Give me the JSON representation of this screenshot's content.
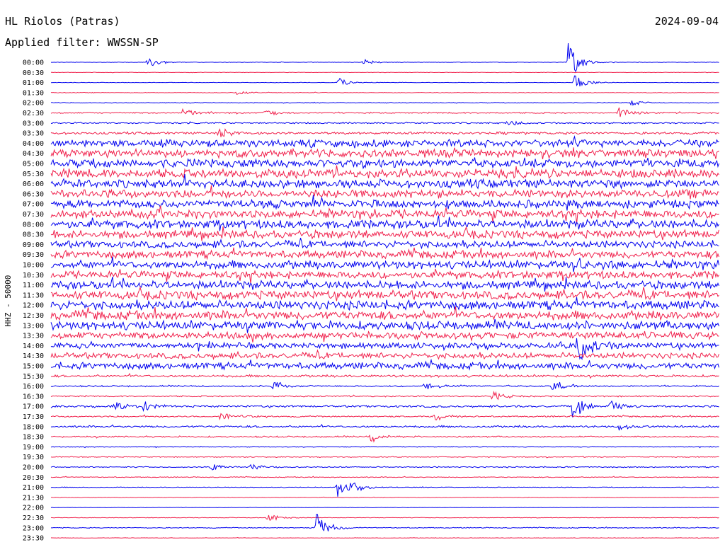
{
  "header": {
    "station": "HL Riolos (Patras)",
    "date": "2024-09-04",
    "filter": "Applied filter: WWSSN-SP"
  },
  "ylabel": "HHZ - 50000",
  "colors": {
    "even_rows": "#0000ee",
    "odd_rows": "#f0204c",
    "text": "#000000"
  },
  "chart_data": {
    "type": "line",
    "title": "HL Riolos (Patras)",
    "date": "2024-09-04",
    "filter": "WWSSN-SP",
    "ylabel": "HHZ - 50000",
    "grid": false,
    "row_labels": [
      "00:00",
      "00:30",
      "01:00",
      "01:30",
      "02:00",
      "02:30",
      "03:00",
      "03:30",
      "04:00",
      "04:30",
      "05:00",
      "05:30",
      "06:00",
      "06:30",
      "07:00",
      "07:30",
      "08:00",
      "08:30",
      "09:00",
      "09:30",
      "10:00",
      "10:30",
      "11:00",
      "11:30",
      "12:00",
      "12:30",
      "13:00",
      "13:30",
      "14:00",
      "14:30",
      "15:00",
      "15:30",
      "16:00",
      "16:30",
      "17:00",
      "17:30",
      "18:00",
      "18:30",
      "19:00",
      "19:30",
      "20:00",
      "20:30",
      "21:00",
      "21:30",
      "22:00",
      "22:30",
      "23:00",
      "23:30"
    ],
    "row_colors": [
      "#0000ee",
      "#f0204c"
    ],
    "row_minutes": 30,
    "noise_level": [
      0.3,
      0.3,
      0.3,
      0.4,
      0.5,
      0.9,
      1.0,
      1.6,
      5.0,
      5.5,
      5.8,
      6.0,
      5.8,
      5.5,
      5.5,
      5.8,
      5.8,
      5.5,
      4.8,
      5.2,
      5.5,
      5.2,
      5.5,
      5.8,
      6.0,
      6.0,
      5.8,
      4.8,
      4.0,
      4.0,
      4.5,
      1.6,
      1.0,
      0.9,
      1.4,
      1.0,
      1.4,
      1.0,
      0.6,
      0.6,
      0.8,
      0.6,
      0.5,
      0.4,
      0.3,
      0.4,
      0.6,
      0.3
    ],
    "events": [
      {
        "row": 0,
        "minute": 4.3,
        "amp": 12
      },
      {
        "row": 0,
        "minute": 14.0,
        "amp": 6
      },
      {
        "row": 0,
        "minute": 23.2,
        "amp": 32
      },
      {
        "row": 2,
        "minute": 12.9,
        "amp": 8
      },
      {
        "row": 2,
        "minute": 23.5,
        "amp": 18
      },
      {
        "row": 3,
        "minute": 8.3,
        "amp": 6
      },
      {
        "row": 4,
        "minute": 26.0,
        "amp": 6
      },
      {
        "row": 5,
        "minute": 5.9,
        "amp": 9
      },
      {
        "row": 5,
        "minute": 9.5,
        "amp": 8
      },
      {
        "row": 5,
        "minute": 25.5,
        "amp": 10
      },
      {
        "row": 6,
        "minute": 20.5,
        "amp": 6
      },
      {
        "row": 7,
        "minute": 7.5,
        "amp": 10
      },
      {
        "row": 20,
        "minute": 23.6,
        "amp": 8
      },
      {
        "row": 28,
        "minute": 23.6,
        "amp": 40
      },
      {
        "row": 32,
        "minute": 9.9,
        "amp": 12
      },
      {
        "row": 32,
        "minute": 16.7,
        "amp": 10
      },
      {
        "row": 32,
        "minute": 22.5,
        "amp": 8
      },
      {
        "row": 33,
        "minute": 19.8,
        "amp": 12
      },
      {
        "row": 34,
        "minute": 2.7,
        "amp": 10
      },
      {
        "row": 34,
        "minute": 4.1,
        "amp": 10
      },
      {
        "row": 34,
        "minute": 23.4,
        "amp": 24
      },
      {
        "row": 34,
        "minute": 25.1,
        "amp": 14
      },
      {
        "row": 35,
        "minute": 7.6,
        "amp": 12
      },
      {
        "row": 35,
        "minute": 17.2,
        "amp": 8
      },
      {
        "row": 36,
        "minute": 25.5,
        "amp": 6
      },
      {
        "row": 37,
        "minute": 14.3,
        "amp": 8
      },
      {
        "row": 40,
        "minute": 7.2,
        "amp": 8
      },
      {
        "row": 40,
        "minute": 8.9,
        "amp": 8
      },
      {
        "row": 42,
        "minute": 12.8,
        "amp": 18
      },
      {
        "row": 42,
        "minute": 13.4,
        "amp": 14
      },
      {
        "row": 45,
        "minute": 9.7,
        "amp": 8
      },
      {
        "row": 46,
        "minute": 11.9,
        "amp": 28
      }
    ]
  }
}
